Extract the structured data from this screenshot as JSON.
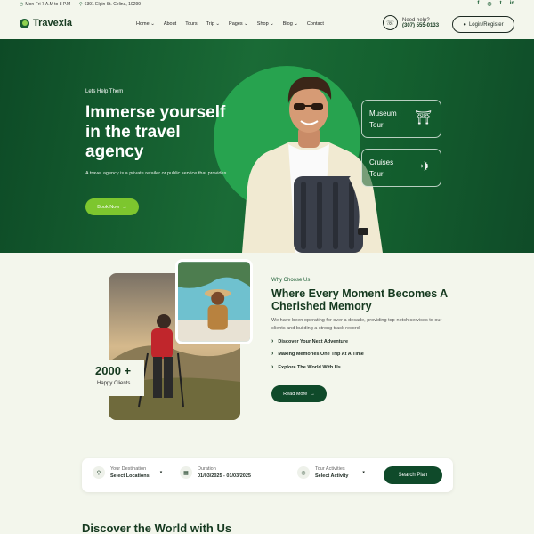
{
  "topbar": {
    "hours": "Mon-Fri 7 A.M to 8 P.M",
    "address": "6391 Elgin St. Celina, 10299",
    "social": [
      "f",
      "◎",
      "t",
      "in"
    ]
  },
  "nav": {
    "brand": "Travexia",
    "menu": [
      "Home",
      "About",
      "Tours",
      "Trip",
      "Pages",
      "Shop",
      "Blog",
      "Contact"
    ],
    "menu_has_dropdown": [
      true,
      false,
      false,
      true,
      true,
      true,
      true,
      false
    ],
    "help_label": "Need help?",
    "help_phone": "(307) 555-0133",
    "login_label": "Login/Register"
  },
  "hero": {
    "eyebrow": "Lets Help Them",
    "title": "Immerse yourself in the travel agency",
    "description": "A travel agency is a private retailer or public service that provides",
    "cta": "Book Now",
    "cards": [
      {
        "label": "Museum Tour",
        "icon": "museum-icon"
      },
      {
        "label": "Cruises Tour",
        "icon": "airplane-icon"
      }
    ]
  },
  "why": {
    "stat_value": "2000 +",
    "stat_label": "Happy Clients",
    "eyebrow": "Why Choose Us",
    "title": "Where Every Moment Becomes A Cherished Memory",
    "description": "We have been operating for over a decade, providing top-notch services to our clients and building a strong track record",
    "features": [
      "Discover Your Next Adventure",
      "Making Memories One Trip At A Time",
      "Explore The World With Us"
    ],
    "cta": "Read More"
  },
  "search": {
    "destination_label": "Your Destination",
    "destination_value": "Select Locations",
    "duration_label": "Duration",
    "duration_value": "01/03/2025 - 01/03/2025",
    "activity_label": "Tour Activities",
    "activity_value": "Select Activity",
    "button": "Search Plan"
  },
  "section_title": "Discover the World with Us",
  "colors": {
    "primary_dark": "#0f4a2a",
    "accent_green": "#7dc62e",
    "hero_green": "#1a6b36",
    "page_bg": "#f3f6ec"
  }
}
